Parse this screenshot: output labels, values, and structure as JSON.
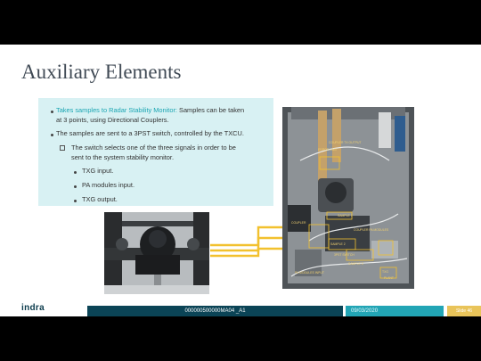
{
  "slide": {
    "title": "Auxiliary Elements",
    "bullets": {
      "b1_accent": "Takes samples to Radar Stability Monitor:",
      "b1_rest": " Samples can be taken",
      "b1_line2": "at 3 points, using Directional Couplers.",
      "b2": "The samples are sent to a 3PST switch, controlled by the TXCU.",
      "sub_line1": "The switch selects one of the three signals in order to be",
      "sub_line2": "sent to the system stability monitor.",
      "items": [
        "TXG input.",
        "PA modules input.",
        "TXG output."
      ]
    },
    "photo_labels": [
      "COUPLER TX OUTPUT",
      "ERROR LIMIT",
      "SAMPLE 1",
      "COUPLER",
      "COUPLER PA MODULES",
      "SAMPLE 2",
      "3PST SWITCH",
      "SAMPLE 3",
      "PA MODULES INPUT",
      "TXG",
      "PLANT"
    ],
    "colors": {
      "accent": "#1aa5b2",
      "footer_dark": "#0b4456",
      "footer_teal": "#22a5b5",
      "footer_gold": "#e9c45a",
      "arrow": "#f2c12e"
    }
  },
  "footer": {
    "logo": "indra",
    "doc_code": "000000500000MA04 _A1",
    "date": "09/03/2020",
    "page": "Slide 46"
  }
}
